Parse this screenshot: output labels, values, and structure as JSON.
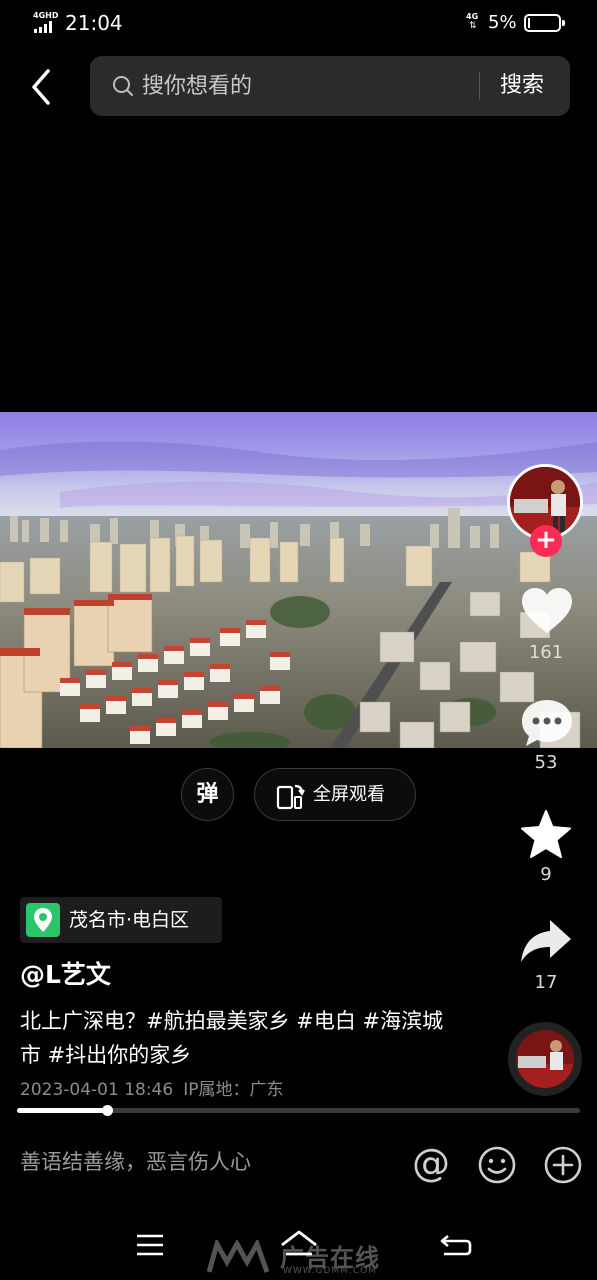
{
  "status_bar": {
    "network": "4GHD",
    "time": "21:04",
    "network_right": "4G",
    "battery": "5%",
    "battery_level": 0.05
  },
  "search": {
    "placeholder": "搜你想看的",
    "button_label": "搜索"
  },
  "video_controls": {
    "danmu_label": "弹",
    "fullscreen_label": "全屏观看"
  },
  "actions": {
    "likes": "161",
    "comments": "53",
    "favorites": "9",
    "shares": "17",
    "follow_symbol": "+"
  },
  "post": {
    "location": "茂名市·电白区",
    "author": "@L艺文",
    "description": "北上广深电？#航拍最美家乡 #电白 #海滨城市 #抖出你的家乡",
    "date": "2023-04-01 18:46",
    "ip": "IP属地：广东",
    "progress": 0.16
  },
  "comment_bar": {
    "placeholder": "善语结善缘，恶言伤人心",
    "at_symbol": "@"
  },
  "watermark": {
    "name": "广告在线",
    "url": "WWW.GDMM.COM"
  },
  "colors": {
    "accent_red": "#fe2c55",
    "location_green": "#2bc46b"
  },
  "icons": [
    "back-icon",
    "search-icon",
    "fullscreen-rotate-icon",
    "heart-icon",
    "comment-icon",
    "star-icon",
    "share-icon",
    "location-pin-icon",
    "emoji-icon",
    "plus-circle-icon",
    "menu-icon",
    "home-icon",
    "back-nav-icon"
  ]
}
